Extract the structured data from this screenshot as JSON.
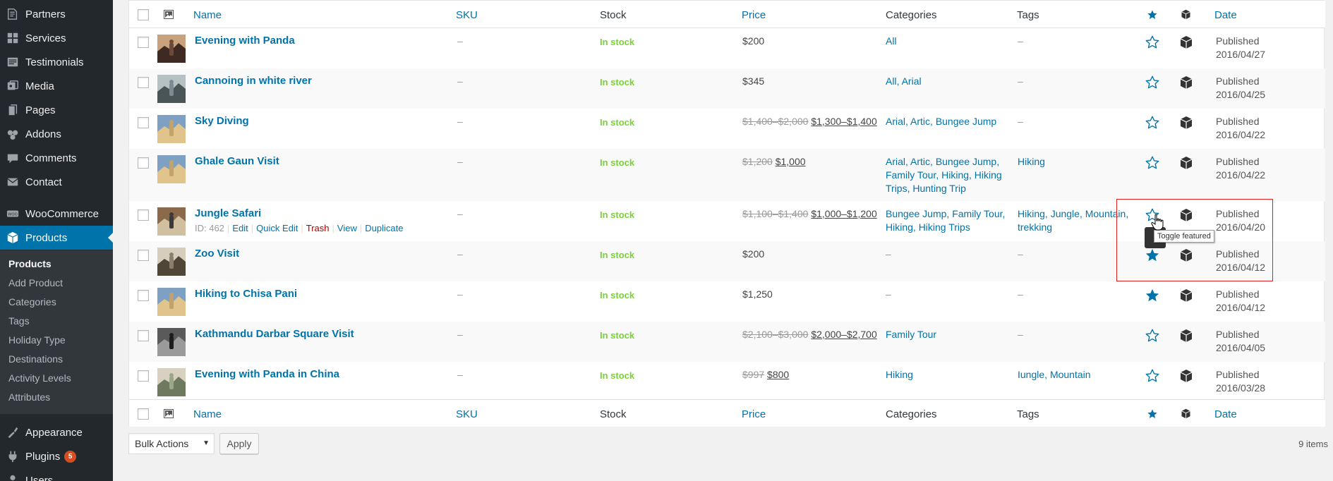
{
  "sidebar": {
    "menu": [
      {
        "label": "Partners",
        "icon": "partners-icon"
      },
      {
        "label": "Services",
        "icon": "grid-icon"
      },
      {
        "label": "Testimonials",
        "icon": "testimonial-icon"
      },
      {
        "label": "Media",
        "icon": "media-icon"
      },
      {
        "label": "Pages",
        "icon": "pages-icon"
      },
      {
        "label": "Addons",
        "icon": "addons-icon"
      },
      {
        "label": "Comments",
        "icon": "comments-icon"
      },
      {
        "label": "Contact",
        "icon": "mail-icon"
      },
      {
        "label": "WooCommerce",
        "icon": "woocommerce-icon"
      },
      {
        "label": "Products",
        "icon": "products-icon"
      },
      {
        "label": "Appearance",
        "icon": "appearance-icon"
      },
      {
        "label": "Plugins",
        "icon": "plugins-icon",
        "badge": "5"
      },
      {
        "label": "Users",
        "icon": "users-icon"
      }
    ],
    "submenu": [
      "Products",
      "Add Product",
      "Categories",
      "Tags",
      "Holiday Type",
      "Destinations",
      "Activity Levels",
      "Attributes"
    ]
  },
  "table": {
    "columns": {
      "name": "Name",
      "sku": "SKU",
      "stock": "Stock",
      "price": "Price",
      "categories": "Categories",
      "tags": "Tags",
      "date": "Date"
    },
    "rows": [
      {
        "name": "Evening with Panda",
        "sku": "–",
        "stock": "In stock",
        "price_old": "",
        "price": "$200",
        "categories": [
          "All"
        ],
        "tags": [
          "–"
        ],
        "featured": false,
        "status": "Published",
        "date": "2016/04/27"
      },
      {
        "name": "Cannoing in white river",
        "sku": "–",
        "stock": "In stock",
        "price_old": "",
        "price": "$345",
        "categories": [
          "All",
          "Arial"
        ],
        "tags": [
          "–"
        ],
        "featured": false,
        "status": "Published",
        "date": "2016/04/25"
      },
      {
        "name": "Sky Diving",
        "sku": "–",
        "stock": "In stock",
        "price_old": "$1,400–$2,000",
        "price": "$1,300–$1,400",
        "categories": [
          "Arial",
          "Artic",
          "Bungee Jump"
        ],
        "tags": [
          "–"
        ],
        "featured": false,
        "status": "Published",
        "date": "2016/04/22"
      },
      {
        "name": "Ghale Gaun Visit",
        "sku": "–",
        "stock": "In stock",
        "price_old": "$1,200",
        "price": "$1,000",
        "categories": [
          "Arial",
          "Artic",
          "Bungee Jump",
          "Family Tour",
          "Hiking",
          "Hiking Trips",
          "Hunting Trip"
        ],
        "tags": [
          "Hiking"
        ],
        "featured": false,
        "status": "Published",
        "date": "2016/04/22"
      },
      {
        "name": "Jungle Safari",
        "sku": "–",
        "stock": "In stock",
        "price_old": "$1,100–$1,400",
        "price": "$1,000–$1,200",
        "categories": [
          "Bungee Jump",
          "Family Tour",
          "Hiking",
          "Hiking Trips"
        ],
        "tags": [
          "Hiking",
          "Jungle",
          "Mountain",
          "trekking"
        ],
        "featured": false,
        "status": "Published",
        "date": "2016/04/20",
        "row_actions": {
          "id": "ID: 462",
          "edit": "Edit",
          "quick_edit": "Quick Edit",
          "trash": "Trash",
          "view": "View",
          "duplicate": "Duplicate"
        }
      },
      {
        "name": "Zoo Visit",
        "sku": "–",
        "stock": "In stock",
        "price_old": "",
        "price": "$200",
        "categories": [
          "–"
        ],
        "tags": [
          "–"
        ],
        "featured": true,
        "status": "Published",
        "date": "2016/04/12"
      },
      {
        "name": "Hiking to Chisa Pani",
        "sku": "–",
        "stock": "In stock",
        "price_old": "",
        "price": "$1,250",
        "categories": [
          "–"
        ],
        "tags": [
          "–"
        ],
        "featured": true,
        "status": "Published",
        "date": "2016/04/12"
      },
      {
        "name": "Kathmandu Darbar Square Visit",
        "sku": "–",
        "stock": "In stock",
        "price_old": "$2,100–$3,000",
        "price": "$2,000–$2,700",
        "categories": [
          "Family Tour"
        ],
        "tags": [
          "–"
        ],
        "featured": false,
        "status": "Published",
        "date": "2016/04/05"
      },
      {
        "name": "Evening with Panda in China",
        "sku": "–",
        "stock": "In stock",
        "price_old": "$997",
        "price": "$800",
        "categories": [
          "Hiking"
        ],
        "tags": [
          "Iungle",
          "Mountain"
        ],
        "featured": false,
        "status": "Published",
        "date": "2016/03/28"
      }
    ]
  },
  "tooltip": "Toggle featured",
  "bottom": {
    "bulk_actions": "Bulk Actions",
    "apply": "Apply",
    "count": "9 items"
  },
  "colors": {
    "accent": "#0073aa",
    "sidebar_bg": "#23282d",
    "in_stock": "#7ad03a",
    "highlight": "#e02020"
  }
}
